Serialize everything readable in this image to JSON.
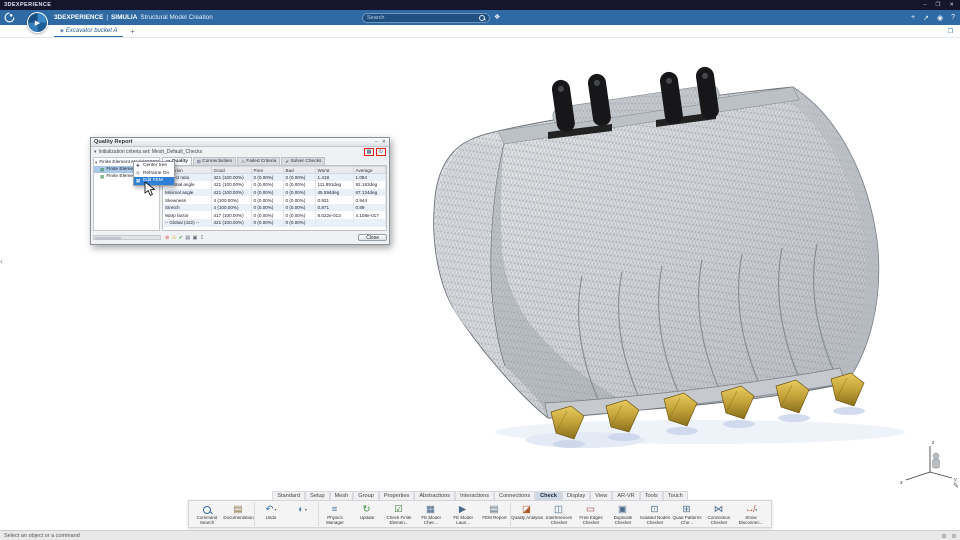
{
  "titlebar": {
    "brand": "3DEXPERIENCE",
    "window_buttons": [
      {
        "name": "minimize-button",
        "glyph": "–"
      },
      {
        "name": "restore-button",
        "glyph": "❐"
      },
      {
        "name": "close-button",
        "glyph": "✕"
      }
    ]
  },
  "appbar": {
    "brand": "3DEXPERIENCE",
    "divider": "|",
    "app": "SIMULIA",
    "module": "Structural Model Creation",
    "search_placeholder": "Search",
    "tag_glyph": "❖",
    "compass_glyph": "▶",
    "right_icons": [
      {
        "name": "add-icon",
        "glyph": "+"
      },
      {
        "name": "share-icon",
        "glyph": "↗"
      },
      {
        "name": "user-icon",
        "glyph": "◉"
      },
      {
        "name": "help-icon",
        "glyph": "?"
      }
    ]
  },
  "tabbar": {
    "tab_icon_glyph": "◈",
    "tab_label": "Excavator bucket A",
    "add_tab_glyph": "+",
    "right_icon_glyph": "❐"
  },
  "viewport": {
    "collapse_glyph": "‹",
    "edit_glyph": "✎"
  },
  "triad": {
    "x": "x",
    "y": "y",
    "z": "z"
  },
  "quality_report": {
    "title": "Quality Report",
    "titlebar_buttons": [
      {
        "name": "dialog-minimize-button",
        "glyph": "–"
      },
      {
        "name": "dialog-close-button",
        "glyph": "✕"
      }
    ],
    "tree_toggle_glyph": "▾",
    "subtitle": "Initialization criteria set: Mesh_Default_Checks",
    "highlighted_icons": [
      {
        "name": "report-table-icon",
        "glyph": "▦"
      },
      {
        "name": "report-refresh-icon",
        "glyph": "↻"
      }
    ],
    "tree_items": [
      {
        "name": "tree-item-fem-root",
        "glyph": "▾",
        "glyph_color": "#555555",
        "label": "Finite Element Model00000001_B"
      },
      {
        "name": "tree-item-fem-1",
        "glyph": "▦",
        "glyph_color": "#3f8f4f",
        "label": "Finite Eleme...",
        "indent": 1,
        "selected": true
      },
      {
        "name": "tree-item-fem-2",
        "glyph": "▦",
        "glyph_color": "#3f8f4f",
        "label": "Finite Eleme...",
        "indent": 1
      }
    ],
    "context_menu": [
      {
        "name": "menu-item-center-tree",
        "glyph": "✚",
        "label": "Center tree"
      },
      {
        "name": "menu-item-reframe-on",
        "glyph": "◎",
        "label": "Reframe On"
      },
      {
        "name": "menu-item-edit-fem",
        "glyph": "▦",
        "label": "Edit FEM",
        "active": true
      }
    ],
    "tabs": [
      {
        "name": "tab-quality",
        "glyph": "◪",
        "label": "Quality",
        "active": true
      },
      {
        "name": "tab-connectivities",
        "glyph": "⊞",
        "label": "Connectivities"
      },
      {
        "name": "tab-failed-criteria",
        "glyph": "⚠",
        "label": "Failed Criteria"
      },
      {
        "name": "tab-solver-checks",
        "glyph": "✔",
        "label": "Solver Checks"
      }
    ],
    "table": {
      "headers": [
        "Criterion",
        "Good",
        "Poor",
        "Bad",
        "Worst",
        "Average"
      ],
      "rows": [
        {
          "criterion": "Aspect ratio",
          "good": "421 (100.00%)",
          "poor": "0 (0.00%)",
          "bad": "0 (0.00%)",
          "worst": "1.418",
          "average": "1.094"
        },
        {
          "criterion": "Maximal angle",
          "good": "421 (100.00%)",
          "poor": "0 (0.00%)",
          "bad": "0 (0.00%)",
          "worst": "111.891deg",
          "average": "92.163deg"
        },
        {
          "criterion": "Minimal angle",
          "good": "421 (100.00%)",
          "poor": "0 (0.00%)",
          "bad": "0 (0.00%)",
          "worst": "45.594deg",
          "average": "67.124deg"
        },
        {
          "criterion": "Skewness",
          "good": "4 (100.00%)",
          "poor": "0 (0.00%)",
          "bad": "0 (0.00%)",
          "worst": "0.931",
          "average": "0.944"
        },
        {
          "criterion": "Stretch",
          "good": "4 (100.00%)",
          "poor": "0 (0.00%)",
          "bad": "0 (0.00%)",
          "worst": "0.871",
          "average": "0.89"
        },
        {
          "criterion": "Warp factor",
          "good": "417 (100.00%)",
          "poor": "0 (0.00%)",
          "bad": "0 (0.00%)",
          "worst": "8.022e-013",
          "average": "4.108e-017"
        },
        {
          "criterion": "-- Global (422) --",
          "good": "421 (100.00%)",
          "poor": "0 (0.00%)",
          "bad": "0 (0.00%)",
          "worst": "",
          "average": ""
        }
      ]
    },
    "footer_icons": [
      {
        "name": "error-icon",
        "glyph": "⊘",
        "color": "#c2332b"
      },
      {
        "name": "warning-icon",
        "glyph": "⚠",
        "color": "#d9a21b"
      },
      {
        "name": "success-icon",
        "glyph": "✔",
        "color": "#3a9a3a"
      },
      {
        "name": "histogram-icon",
        "glyph": "▤",
        "color": "#556677"
      },
      {
        "name": "snapshot-icon",
        "glyph": "▣",
        "color": "#667"
      },
      {
        "name": "export-icon",
        "glyph": "↧",
        "color": "#667"
      }
    ],
    "close_label": "Close"
  },
  "ribbon": {
    "tabs": [
      {
        "name": "ribbon-tab-standard",
        "label": "Standard"
      },
      {
        "name": "ribbon-tab-setup",
        "label": "Setup"
      },
      {
        "name": "ribbon-tab-mesh",
        "label": "Mesh"
      },
      {
        "name": "ribbon-tab-group",
        "label": "Group"
      },
      {
        "name": "ribbon-tab-properties",
        "label": "Properties"
      },
      {
        "name": "ribbon-tab-abstractions",
        "label": "Abstractions"
      },
      {
        "name": "ribbon-tab-interactions",
        "label": "Interactions"
      },
      {
        "name": "ribbon-tab-connections",
        "label": "Connections"
      },
      {
        "name": "ribbon-tab-check",
        "label": "Check",
        "active": true
      },
      {
        "name": "ribbon-tab-display",
        "label": "Display"
      },
      {
        "name": "ribbon-tab-view",
        "label": "View"
      },
      {
        "name": "ribbon-tab-ar-vr",
        "label": "AR-VR"
      },
      {
        "name": "ribbon-tab-tools",
        "label": "Tools"
      },
      {
        "name": "ribbon-tab-touch",
        "label": "Touch"
      }
    ],
    "tools": [
      {
        "name": "command-search-tool",
        "icon": "mag",
        "label": "Command Search",
        "color": "#3a6fa8"
      },
      {
        "name": "documentation-tool",
        "glyph": "▤",
        "label": "Documentation",
        "color": "#8a6d3b",
        "group_end": true
      },
      {
        "name": "undo-tool",
        "glyph": "↶",
        "label": "Undo",
        "color": "#3a6fa8",
        "caret": "▾"
      },
      {
        "name": "view-mode-tool",
        "glyph": "◐",
        "label": "",
        "color": "#4a80b0",
        "caret": "▾",
        "group_end": true
      },
      {
        "name": "physics-manager-tool",
        "glyph": "≡",
        "label": "Physics Manager",
        "color": "#5a7a9a"
      },
      {
        "name": "update-tool",
        "glyph": "↻",
        "label": "Update",
        "color": "#3f8f3f"
      },
      {
        "name": "check-finite-element-tool",
        "glyph": "☑",
        "label": "Check Finite Elemen...",
        "color": "#3a7a3a"
      },
      {
        "name": "fe-model-checks-tool",
        "glyph": "▦",
        "label": "FE Model Chec...",
        "color": "#4a6a8a"
      },
      {
        "name": "fe-model-launcher-tool",
        "glyph": "▶",
        "label": "FE Model Laun...",
        "color": "#4a6a8a"
      },
      {
        "name": "fem-report-tool",
        "glyph": "▤",
        "label": "FEM Report",
        "color": "#5a6a7a",
        "group_end": true
      },
      {
        "name": "quality-analysis-tool",
        "glyph": "◪",
        "label": "Quality Analysis",
        "color": "#b06030"
      },
      {
        "name": "interferences-checker-tool",
        "glyph": "◫",
        "label": "Interferences Checker",
        "color": "#4a6a8a"
      },
      {
        "name": "free-edges-checker-tool",
        "glyph": "▭",
        "label": "Free Edges Checker",
        "color": "#a04040"
      },
      {
        "name": "duplicate-checker-tool",
        "glyph": "▣",
        "label": "Duplicate Checker",
        "color": "#4a6a8a"
      },
      {
        "name": "isolated-nodes-checker-tool",
        "glyph": "⊡",
        "label": "Isolated Nodes Checker",
        "color": "#4a6a8a"
      },
      {
        "name": "quad-patterns-checker-tool",
        "glyph": "⊞",
        "label": "Quad Patterns Che...",
        "color": "#4a6a8a"
      },
      {
        "name": "connection-checker-tool",
        "glyph": "⋈",
        "label": "Connection Checker",
        "color": "#4a6a8a"
      },
      {
        "name": "show-disconnections-tool",
        "glyph": "↮",
        "label": "Show Disconnec...",
        "color": "#b05030",
        "caret": "▾"
      }
    ]
  },
  "statusbar": {
    "message": "Select an object or a command"
  }
}
